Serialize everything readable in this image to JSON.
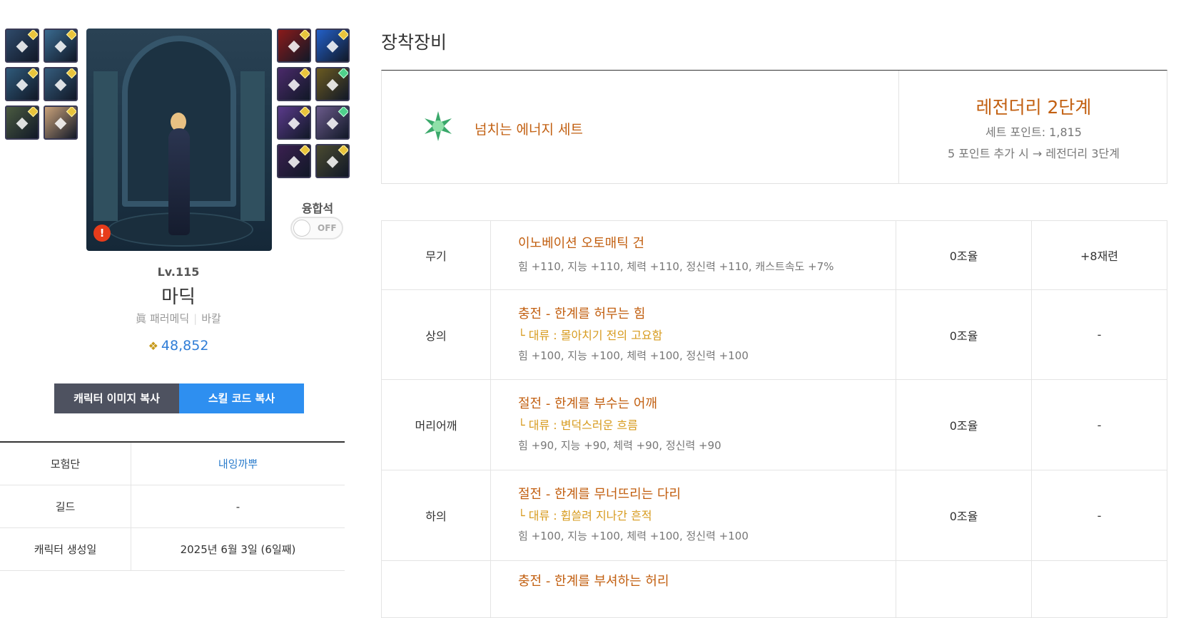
{
  "character": {
    "level": "Lv.115",
    "name": "마딕",
    "job": "眞 패러메딕",
    "server": "바칼",
    "power_value": "48,852"
  },
  "left_slots": [
    {
      "icon": "helmet-icon",
      "color": "#2f4a6a"
    },
    {
      "icon": "armor-icon",
      "color": "#3a6a8f"
    },
    {
      "icon": "shoulder-icon",
      "color": "#2f5a7a"
    },
    {
      "icon": "pants-icon",
      "color": "#355c7c"
    },
    {
      "icon": "boots-icon",
      "color": "#4a5a40"
    },
    {
      "icon": "hamster-icon",
      "color": "#caa27a"
    }
  ],
  "right_slots": [
    {
      "icon": "box-icon",
      "color": "#8a1a1a"
    },
    {
      "icon": "crystal-icon",
      "color": "#2360c8"
    },
    {
      "icon": "orb-icon",
      "color": "#4a2a6a"
    },
    {
      "icon": "claw-icon",
      "color": "#6a5a20"
    },
    {
      "icon": "stone-icon",
      "color": "#5a3a8a"
    },
    {
      "icon": "boot-icon",
      "color": "#6a5a8a"
    },
    {
      "icon": "ring-icon",
      "color": "#3a2050"
    },
    {
      "icon": "blade-icon",
      "color": "#4a4a30"
    }
  ],
  "fusion": {
    "label": "융합석",
    "toggle_text": "OFF"
  },
  "buttons": {
    "copy_image": "캐릭터 이미지 복사",
    "copy_skill": "스킬 코드 복사"
  },
  "info_rows": [
    {
      "key": "모험단",
      "value": "내잉까뿌"
    },
    {
      "key": "길드",
      "value": "-"
    },
    {
      "key": "캐릭터 생성일",
      "value": "2025년 6월 3일 (6일째)"
    }
  ],
  "equipment_section": {
    "title": "장착장비",
    "set": {
      "name": "넘치는 에너지 세트",
      "grade": "레전더리 2단계",
      "point": "세트 포인트: 1,815",
      "next": "5 포인트 추가 시 → 레전더리 3단계"
    },
    "items": [
      {
        "slot": "무기",
        "name": "이노베이션 오토매틱 건",
        "sub": "",
        "stats": "힘 +110, 지능 +110, 체력 +110, 정신력 +110, 캐스트속도 +7%",
        "tune": "0조율",
        "reforge": "+8재련"
      },
      {
        "slot": "상의",
        "name": "충전 - 한계를 허무는 힘",
        "sub": "└ 대류 : 몰아치기 전의 고요함",
        "stats": "힘 +100, 지능 +100, 체력 +100, 정신력 +100",
        "tune": "0조율",
        "reforge": "-"
      },
      {
        "slot": "머리어깨",
        "name": "절전 - 한계를 부수는 어깨",
        "sub": "└ 대류 : 변덕스러운 흐름",
        "stats": "힘 +90, 지능 +90, 체력 +90, 정신력 +90",
        "tune": "0조율",
        "reforge": "-"
      },
      {
        "slot": "하의",
        "name": "절전 - 한계를 무너뜨리는 다리",
        "sub": "└ 대류 : 휩쓸려 지나간 흔적",
        "stats": "힘 +100, 지능 +100, 체력 +100, 정신력 +100",
        "tune": "0조율",
        "reforge": "-"
      },
      {
        "slot": "",
        "name": "충전 - 한계를 부셔하는 허리",
        "sub": "",
        "stats": "",
        "tune": "",
        "reforge": ""
      }
    ]
  }
}
